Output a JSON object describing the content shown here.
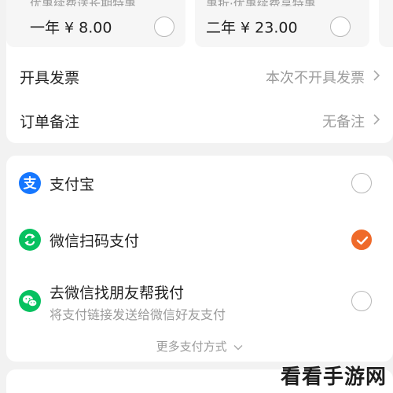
{
  "plans": [
    {
      "cut_text": "优惠续费送长期特惠",
      "price": "一年 ¥ 8.00",
      "selected": false
    },
    {
      "cut_text": "惠折·优惠续费享特惠",
      "price": "二年 ¥ 23.00",
      "selected": false
    }
  ],
  "invoice": {
    "label": "开具发票",
    "value": "本次不开具发票"
  },
  "remark": {
    "label": "订单备注",
    "value": "无备注"
  },
  "payment": {
    "options": [
      {
        "icon": "alipay-icon",
        "title": "支付宝",
        "subtitle": "",
        "selected": false
      },
      {
        "icon": "wechat-scan-icon",
        "title": "微信扫码支付",
        "subtitle": "",
        "selected": true
      },
      {
        "icon": "wechat-friend-icon",
        "title": "去微信找朋友帮我付",
        "subtitle": "将支付链接发送给微信好友支付",
        "selected": false
      }
    ],
    "more_label": "更多支付方式"
  },
  "watermark": "看看手游网",
  "colors": {
    "accent": "#ef6a2a",
    "alipay": "#1677ff",
    "wechat": "#07c160",
    "background": "#f2f2f2"
  }
}
